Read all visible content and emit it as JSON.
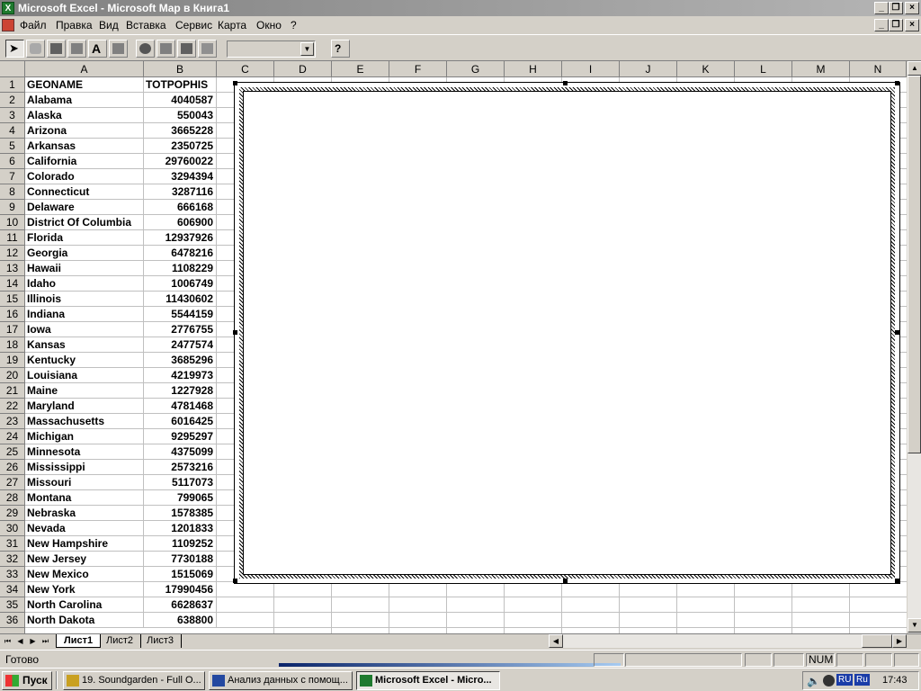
{
  "window": {
    "title": "Microsoft Excel - Microsoft Map в Книга1"
  },
  "menu": [
    "Файл",
    "Правка",
    "Вид",
    "Вставка",
    "Сервис",
    "Карта",
    "Окно",
    "?"
  ],
  "toolbar": {
    "dropdown_value": ""
  },
  "columns": [
    "A",
    "B",
    "C",
    "D",
    "E",
    "F",
    "G",
    "H",
    "I",
    "J",
    "K",
    "L",
    "M",
    "N"
  ],
  "sheet": {
    "header_a": "GEONAME",
    "header_b": "TOTPOPHIS",
    "rows": [
      {
        "n": "2",
        "a": "Alabama",
        "b": "4040587"
      },
      {
        "n": "3",
        "a": "Alaska",
        "b": "550043"
      },
      {
        "n": "4",
        "a": "Arizona",
        "b": "3665228"
      },
      {
        "n": "5",
        "a": "Arkansas",
        "b": "2350725"
      },
      {
        "n": "6",
        "a": "California",
        "b": "29760022"
      },
      {
        "n": "7",
        "a": "Colorado",
        "b": "3294394"
      },
      {
        "n": "8",
        "a": "Connecticut",
        "b": "3287116"
      },
      {
        "n": "9",
        "a": "Delaware",
        "b": "666168"
      },
      {
        "n": "10",
        "a": "District Of Columbia",
        "b": "606900"
      },
      {
        "n": "11",
        "a": "Florida",
        "b": "12937926"
      },
      {
        "n": "12",
        "a": "Georgia",
        "b": "6478216"
      },
      {
        "n": "13",
        "a": "Hawaii",
        "b": "1108229"
      },
      {
        "n": "14",
        "a": "Idaho",
        "b": "1006749"
      },
      {
        "n": "15",
        "a": "Illinois",
        "b": "11430602"
      },
      {
        "n": "16",
        "a": "Indiana",
        "b": "5544159"
      },
      {
        "n": "17",
        "a": "Iowa",
        "b": "2776755"
      },
      {
        "n": "18",
        "a": "Kansas",
        "b": "2477574"
      },
      {
        "n": "19",
        "a": "Kentucky",
        "b": "3685296"
      },
      {
        "n": "20",
        "a": "Louisiana",
        "b": "4219973"
      },
      {
        "n": "21",
        "a": "Maine",
        "b": "1227928"
      },
      {
        "n": "22",
        "a": "Maryland",
        "b": "4781468"
      },
      {
        "n": "23",
        "a": "Massachusetts",
        "b": "6016425"
      },
      {
        "n": "24",
        "a": "Michigan",
        "b": "9295297"
      },
      {
        "n": "25",
        "a": "Minnesota",
        "b": "4375099"
      },
      {
        "n": "26",
        "a": "Mississippi",
        "b": "2573216"
      },
      {
        "n": "27",
        "a": "Missouri",
        "b": "5117073"
      },
      {
        "n": "28",
        "a": "Montana",
        "b": "799065"
      },
      {
        "n": "29",
        "a": "Nebraska",
        "b": "1578385"
      },
      {
        "n": "30",
        "a": "Nevada",
        "b": "1201833"
      },
      {
        "n": "31",
        "a": "New Hampshire",
        "b": "1109252"
      },
      {
        "n": "32",
        "a": "New Jersey",
        "b": "7730188"
      },
      {
        "n": "33",
        "a": "New Mexico",
        "b": "1515069"
      },
      {
        "n": "34",
        "a": "New York",
        "b": "17990456"
      },
      {
        "n": "35",
        "a": "North Carolina",
        "b": "6628637"
      },
      {
        "n": "36",
        "a": "North Dakota",
        "b": "638800"
      }
    ]
  },
  "sheet_tabs": [
    "Лист1",
    "Лист2",
    "Лист3"
  ],
  "status": {
    "ready": "Готово",
    "num": "NUM"
  },
  "taskbar": {
    "start": "Пуск",
    "tasks": [
      "19. Soundgarden - Full O...",
      "Анализ данных с помощ...",
      "Microsoft Excel - Micro..."
    ],
    "lang1": "RU",
    "lang2": "Ru",
    "clock": "17:43"
  },
  "colors": {
    "title_gradient_start": "#808080",
    "excel_green": "#1e7a2e",
    "face": "#d4d0c8"
  }
}
